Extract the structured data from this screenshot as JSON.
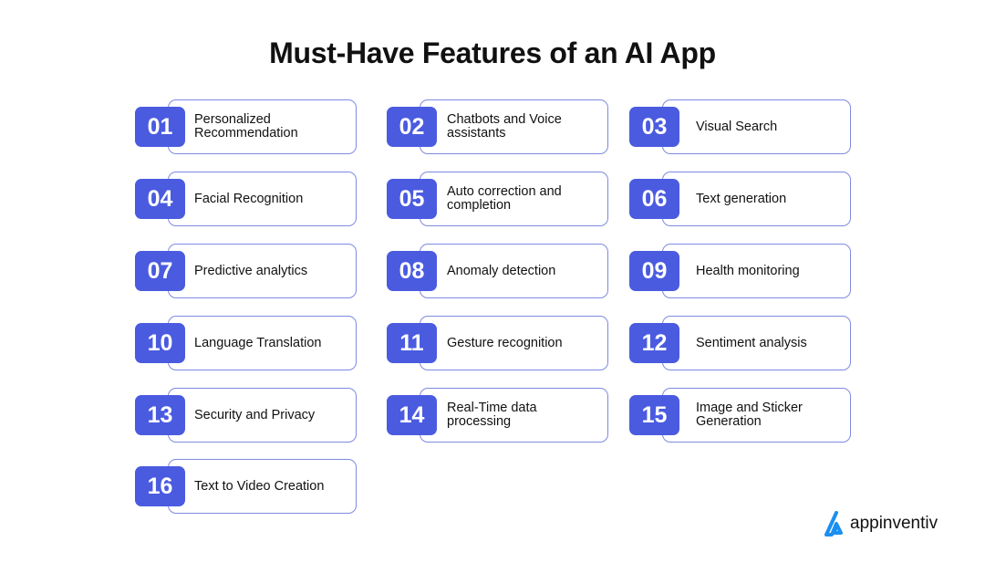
{
  "title": "Must-Have Features of an AI App",
  "brand": {
    "name": "appinventiv",
    "accent": "#1a8ff0"
  },
  "colors": {
    "badge": "#4a5be0",
    "card_border": "#7f8ae0"
  },
  "features": [
    {
      "num": "01",
      "label": "Personalized Recommendation"
    },
    {
      "num": "02",
      "label": "Chatbots and Voice assistants"
    },
    {
      "num": "03",
      "label": "Visual Search"
    },
    {
      "num": "04",
      "label": "Facial Recognition"
    },
    {
      "num": "05",
      "label": "Auto correction and completion"
    },
    {
      "num": "06",
      "label": "Text generation"
    },
    {
      "num": "07",
      "label": "Predictive analytics"
    },
    {
      "num": "08",
      "label": "Anomaly detection"
    },
    {
      "num": "09",
      "label": "Health monitoring"
    },
    {
      "num": "10",
      "label": "Language Translation"
    },
    {
      "num": "11",
      "label": "Gesture recognition"
    },
    {
      "num": "12",
      "label": "Sentiment analysis"
    },
    {
      "num": "13",
      "label": "Security and Privacy"
    },
    {
      "num": "14",
      "label": "Real-Time data processing"
    },
    {
      "num": "15",
      "label": "Image and Sticker Generation"
    },
    {
      "num": "16",
      "label": "Text to Video Creation"
    }
  ]
}
